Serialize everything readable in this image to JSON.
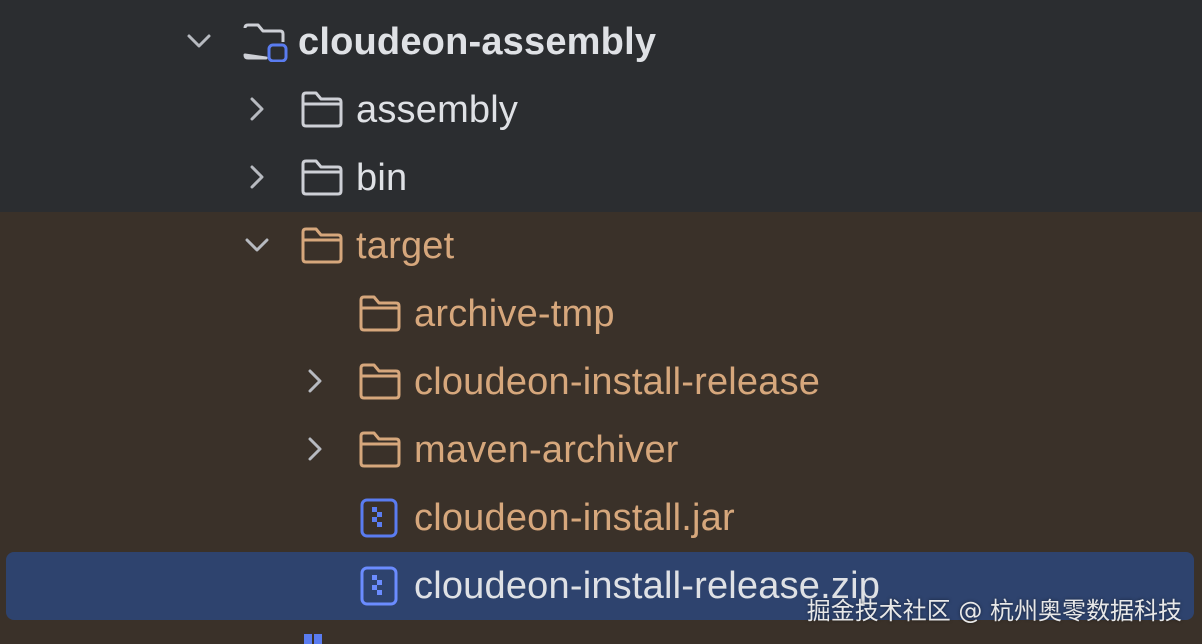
{
  "colors": {
    "background": "#2b2d30",
    "excluded_background": "#3a3129",
    "selection": "#2e436e",
    "text": "#dfe1e5",
    "excluded_text": "#d6a77c",
    "module_badge": "#5a7cf0",
    "archive_icon": "#5a7cf0"
  },
  "tree": {
    "root": {
      "label": "cloudeon-assembly",
      "icon": "module-folder-icon",
      "expanded": true
    },
    "items": [
      {
        "label": "assembly",
        "icon": "folder-icon",
        "expanded": false
      },
      {
        "label": "bin",
        "icon": "folder-icon",
        "expanded": false
      },
      {
        "label": "target",
        "icon": "folder-icon",
        "expanded": true,
        "excluded": true
      },
      {
        "label": "archive-tmp",
        "icon": "folder-icon",
        "excluded": true
      },
      {
        "label": "cloudeon-install-release",
        "icon": "folder-icon",
        "expanded": false,
        "excluded": true
      },
      {
        "label": "maven-archiver",
        "icon": "folder-icon",
        "expanded": false,
        "excluded": true
      },
      {
        "label": "cloudeon-install.jar",
        "icon": "archive-file-icon",
        "excluded": true
      },
      {
        "label": "cloudeon-install-release.zip",
        "icon": "archive-file-icon",
        "excluded": true,
        "selected": true
      }
    ]
  },
  "watermark": "掘金技术社区 @ 杭州奥零数据科技"
}
